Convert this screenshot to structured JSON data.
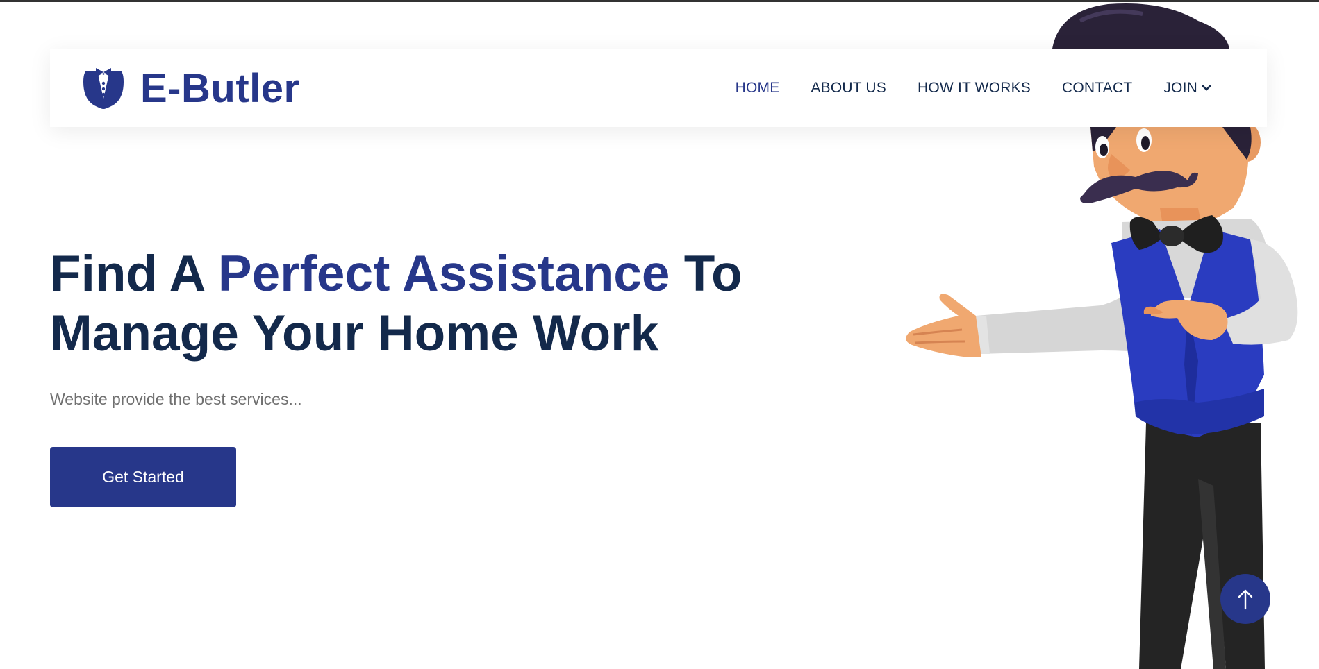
{
  "brand": {
    "name": "E-Butler",
    "logo_icon": "tuxedo-icon",
    "color": "#27378a"
  },
  "nav": {
    "items": [
      {
        "label": "HOME",
        "active": true
      },
      {
        "label": "ABOUT US",
        "active": false
      },
      {
        "label": "HOW IT WORKS",
        "active": false
      },
      {
        "label": "CONTACT",
        "active": false
      },
      {
        "label": "JOIN",
        "active": false,
        "icon": "chevron-down-icon"
      }
    ]
  },
  "hero": {
    "title_part1": "Find A ",
    "title_accent": "Perfect Assistance",
    "title_part2": " To Manage Your Home Work",
    "subtitle": "Website provide the best services...",
    "cta_label": "Get Started"
  },
  "scroll_top": {
    "icon": "arrow-up-icon"
  },
  "colors": {
    "primary": "#27378a",
    "heading": "#13294b",
    "muted": "#707070"
  }
}
